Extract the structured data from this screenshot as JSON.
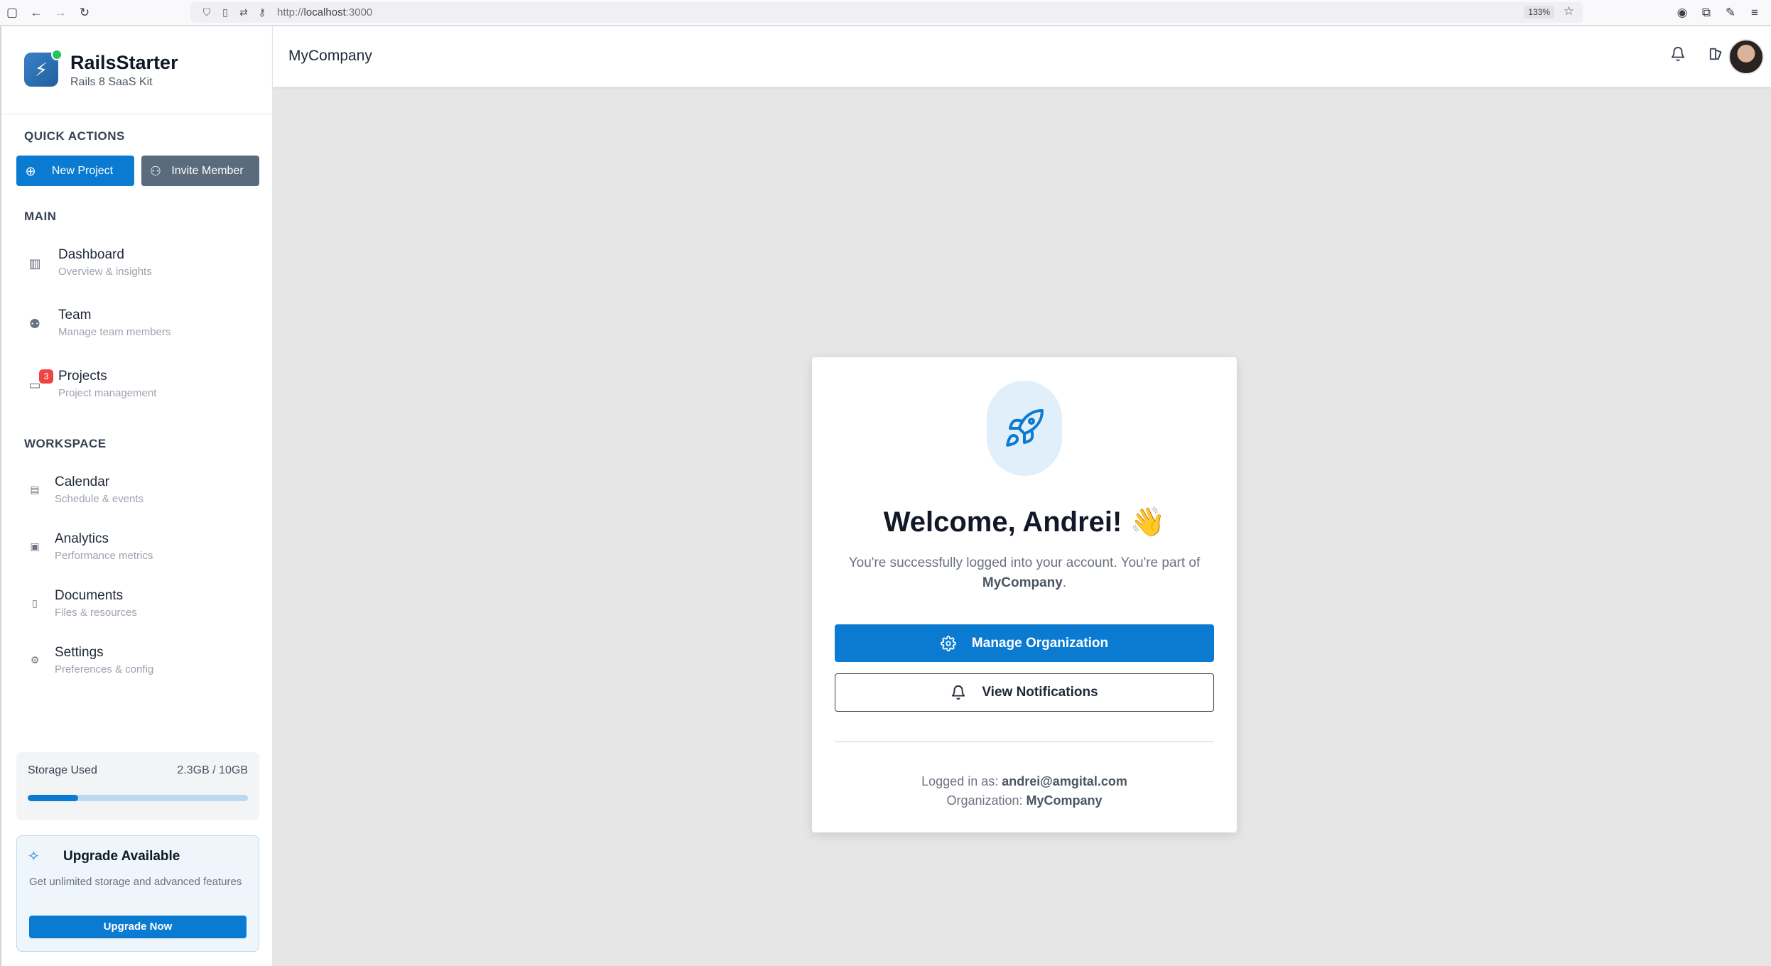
{
  "browser": {
    "url_prefix": "http://",
    "url_host": "localhost",
    "url_port": ":3000",
    "zoom": "133%"
  },
  "brand": {
    "name": "RailsStarter",
    "subtitle": "Rails 8 SaaS Kit"
  },
  "quick_actions": {
    "title": "QUICK ACTIONS",
    "new_project": "New Project",
    "invite_member": "Invite Member"
  },
  "main_section": {
    "title": "MAIN",
    "items": [
      {
        "label": "Dashboard",
        "sub": "Overview & insights"
      },
      {
        "label": "Team",
        "sub": "Manage team members"
      },
      {
        "label": "Projects",
        "sub": "Project management",
        "badge": "3"
      }
    ]
  },
  "workspace_section": {
    "title": "WORKSPACE",
    "items": [
      {
        "label": "Calendar",
        "sub": "Schedule & events"
      },
      {
        "label": "Analytics",
        "sub": "Performance metrics"
      },
      {
        "label": "Documents",
        "sub": "Files & resources"
      },
      {
        "label": "Settings",
        "sub": "Preferences & config"
      }
    ]
  },
  "storage": {
    "label": "Storage Used",
    "value": "2.3GB / 10GB",
    "used_fraction": 0.23
  },
  "upgrade": {
    "title": "Upgrade Available",
    "text": "Get unlimited storage and advanced features",
    "button": "Upgrade Now"
  },
  "header": {
    "org_name": "MyCompany"
  },
  "welcome": {
    "title": "Welcome, Andrei! 👋",
    "text_before": "You're successfully logged into your account. You're part of ",
    "org": "MyCompany",
    "text_after": ".",
    "manage_button": "Manage Organization",
    "notifications_button": "View Notifications",
    "logged_in_label": "Logged in as: ",
    "email": "andrei@amgital.com",
    "org_label": "Organization: ",
    "org_value": "MyCompany"
  },
  "colors": {
    "primary": "#0b7ad1",
    "secondary": "#5b6b7e",
    "badge": "#ef4444",
    "status_dot": "#22c55e"
  },
  "icons": {
    "new_project": "plus-circle-icon",
    "invite_member": "user-plus-icon",
    "manage": "gear-icon",
    "notifications": "bell-icon",
    "hero": "rocket-icon"
  }
}
